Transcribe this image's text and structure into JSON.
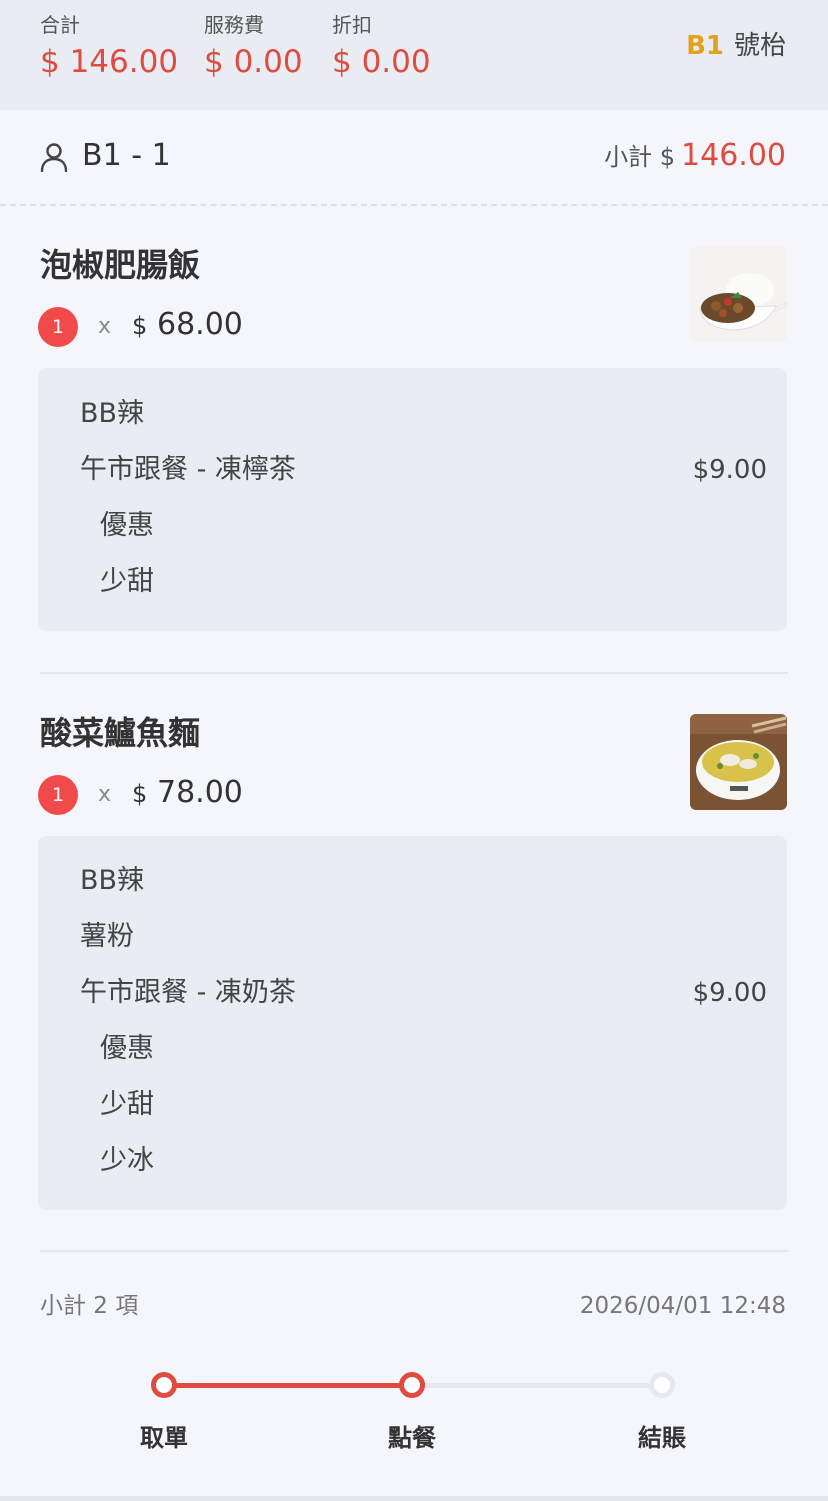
{
  "summary": {
    "total_label": "合計",
    "total_value": "$ 146.00",
    "service_label": "服務費",
    "service_value": "$ 0.00",
    "discount_label": "折扣",
    "discount_value": "$ 0.00",
    "table_code": "B1",
    "table_suffix": "號枱"
  },
  "person": {
    "label": "B1 - 1",
    "subtotal_label": "小計 $",
    "subtotal_value": "146.00"
  },
  "items": [
    {
      "name": "泡椒肥腸飯",
      "qty": "1",
      "times": "x",
      "currency": "$",
      "price": "68.00",
      "image": "rice-dish",
      "options": [
        {
          "text": "BB辣",
          "price": ""
        },
        {
          "text": "午市跟餐 - 凍檸茶",
          "price": "$9.00"
        },
        {
          "text": "優惠",
          "price": ""
        },
        {
          "text": "少甜",
          "price": ""
        }
      ]
    },
    {
      "name": "酸菜鱸魚麵",
      "qty": "1",
      "times": "x",
      "currency": "$",
      "price": "78.00",
      "image": "fish-noodle-bowl",
      "options": [
        {
          "text": "BB辣",
          "price": ""
        },
        {
          "text": "薯粉",
          "price": ""
        },
        {
          "text": "午市跟餐 - 凍奶茶",
          "price": "$9.00"
        },
        {
          "text": "優惠",
          "price": ""
        },
        {
          "text": "少甜",
          "price": ""
        },
        {
          "text": "少冰",
          "price": ""
        }
      ]
    }
  ],
  "footer": {
    "count_label": "小計 2 項",
    "timestamp": "2026/04/01 12:48"
  },
  "steps": [
    {
      "label": "取單",
      "state": "done"
    },
    {
      "label": "點餐",
      "state": "current"
    },
    {
      "label": "結賬",
      "state": "pending"
    }
  ],
  "colors": {
    "accent": "#e04a3f",
    "badge": "#f14a4a",
    "table_code": "#e4a21a",
    "panel": "#e9edf3"
  }
}
